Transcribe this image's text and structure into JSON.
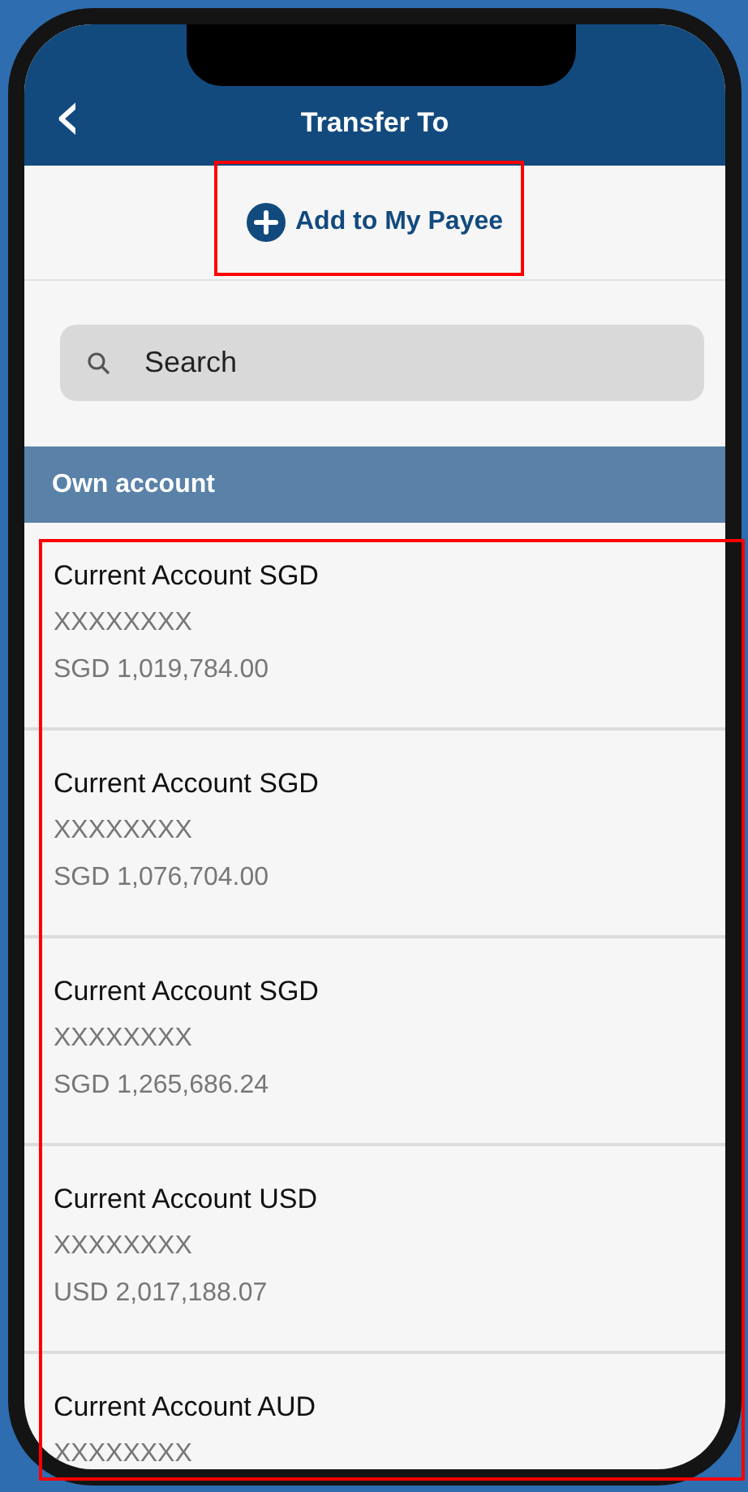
{
  "header": {
    "back_icon": "‹",
    "title": "Transfer To"
  },
  "add_payee": {
    "label": "Add to My Payee",
    "highlighted": true
  },
  "search": {
    "placeholder": "Search"
  },
  "section": {
    "title": "Own account"
  },
  "accounts": {
    "highlighted": true,
    "items": [
      {
        "name": "Current Account SGD",
        "number": "XXXXXXXX",
        "balance": "SGD 1,019,784.00"
      },
      {
        "name": "Current Account SGD",
        "number": "XXXXXXXX",
        "balance": "SGD 1,076,704.00"
      },
      {
        "name": "Current Account SGD",
        "number": "XXXXXXXX",
        "balance": "SGD 1,265,686.24"
      },
      {
        "name": "Current Account USD",
        "number": "XXXXXXXX",
        "balance": "USD 2,017,188.07"
      },
      {
        "name": "Current Account AUD",
        "number": "XXXXXXXX"
      }
    ]
  }
}
